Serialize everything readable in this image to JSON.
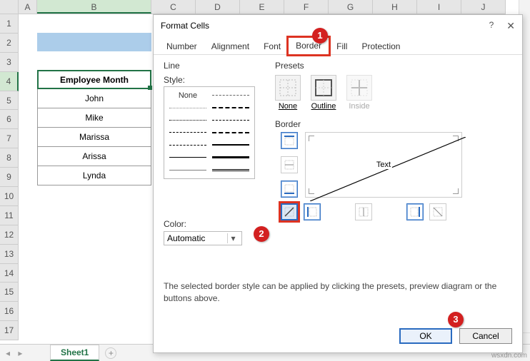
{
  "grid": {
    "cols": [
      "A",
      "B",
      "C",
      "D",
      "E",
      "F",
      "G",
      "H",
      "I",
      "J"
    ],
    "rows": [
      "1",
      "2",
      "3",
      "4",
      "5",
      "6",
      "7",
      "8",
      "9",
      "10",
      "11",
      "12",
      "13",
      "14",
      "15",
      "16",
      "17"
    ],
    "selected_row": "4",
    "selected_col": "B"
  },
  "table": {
    "header": "Employee Month",
    "rows": [
      "John",
      "Mike",
      "Marissa",
      "Arissa",
      "Lynda"
    ]
  },
  "tabstrip": {
    "sheet": "Sheet1",
    "add": "+",
    "nav": "◂ ▸"
  },
  "dialog": {
    "title": "Format Cells",
    "help": "?",
    "close": "✕",
    "tabs": {
      "number": "Number",
      "alignment": "Alignment",
      "font": "Font",
      "border": "Border",
      "fill": "Fill",
      "protection": "Protection"
    },
    "line_label": "Line",
    "style_label": "Style:",
    "style_none": "None",
    "color_label": "Color:",
    "color_value": "Automatic",
    "presets_label": "Presets",
    "preset_none": "None",
    "preset_outline": "Outline",
    "preset_inside": "Inside",
    "border_label": "Border",
    "preview_text": "Text",
    "hint": "The selected border style can be applied by clicking the presets, preview diagram or the buttons above.",
    "ok": "OK",
    "cancel": "Cancel"
  },
  "callouts": {
    "c1": "1",
    "c2": "2",
    "c3": "3"
  },
  "watermark": "wsxdn.com"
}
